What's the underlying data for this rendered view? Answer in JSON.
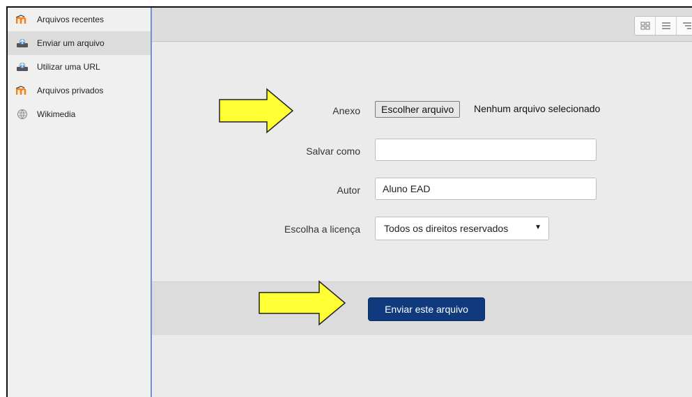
{
  "sidebar": {
    "items": [
      {
        "label": "Arquivos recentes",
        "icon": "moodle-logo-icon",
        "active": false
      },
      {
        "label": "Enviar um arquivo",
        "icon": "upload-icon",
        "active": true
      },
      {
        "label": "Utilizar uma URL",
        "icon": "upload-icon",
        "active": false
      },
      {
        "label": "Arquivos privados",
        "icon": "moodle-logo-icon",
        "active": false
      },
      {
        "label": "Wikimedia",
        "icon": "globe-icon",
        "active": false
      }
    ]
  },
  "toolbar": {
    "view_buttons": [
      "grid-view-icon",
      "list-view-icon",
      "tree-view-icon"
    ]
  },
  "form": {
    "attachment": {
      "label": "Anexo",
      "button_label": "Escolher arquivo",
      "status": "Nenhum arquivo selecionado"
    },
    "save_as": {
      "label": "Salvar como",
      "value": "",
      "placeholder": ""
    },
    "author": {
      "label": "Autor",
      "value": "Aluno EAD"
    },
    "license": {
      "label": "Escolha a licença",
      "selected": "Todos os direitos reservados"
    }
  },
  "footer": {
    "submit_label": "Enviar este arquivo"
  },
  "colors": {
    "accent": "#0f3a7d",
    "arrow_fill": "#ffff33",
    "moodle_orange": "#f98012"
  }
}
